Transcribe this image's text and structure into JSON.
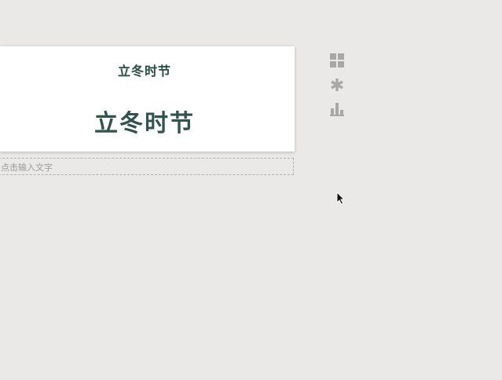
{
  "card": {
    "subtitle": "立冬时节",
    "title": "立冬时节"
  },
  "text_input": {
    "placeholder": "点击输入文字"
  },
  "toolbar": {
    "tools": [
      {
        "icon": "grid-icon",
        "color": "#a8a7a5"
      },
      {
        "icon": "asterisk-icon",
        "color": "#a8a7a5"
      },
      {
        "icon": "bar-chart-icon",
        "color": "#a8a7a5"
      }
    ]
  },
  "colors": {
    "background": "#ebe9e7",
    "card_background": "#ffffff",
    "title_text": "#32534d",
    "icon": "#a8a7a5"
  }
}
